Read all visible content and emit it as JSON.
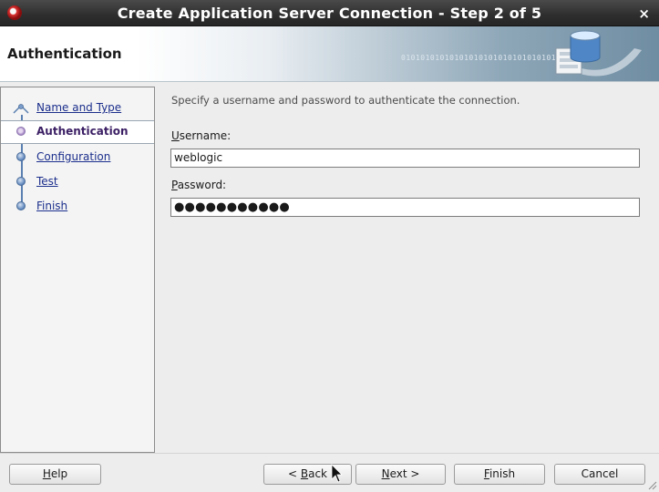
{
  "window": {
    "title": "Create Application Server Connection - Step 2 of 5",
    "close_glyph": "×"
  },
  "header": {
    "title": "Authentication",
    "binary_text": "0101010101010101010101010101010101"
  },
  "nav": {
    "items": [
      {
        "label": "Name and Type",
        "state": "visited"
      },
      {
        "label": "Authentication",
        "state": "current"
      },
      {
        "label": "Configuration",
        "state": "pending"
      },
      {
        "label": "Test",
        "state": "pending"
      },
      {
        "label": "Finish",
        "state": "pending"
      }
    ]
  },
  "content": {
    "description": "Specify a username and password to authenticate the connection.",
    "username": {
      "mnemonic": "U",
      "rest": "sername:",
      "value": "weblogic"
    },
    "password": {
      "mnemonic": "P",
      "rest": "assword:",
      "value": "●●●●●●●●●●●"
    }
  },
  "buttons": {
    "help": {
      "mnemonic": "H",
      "rest": "elp"
    },
    "back": {
      "prefix": "< ",
      "mnemonic": "B",
      "rest": "ack"
    },
    "next": {
      "mnemonic": "N",
      "rest": "ext >"
    },
    "finish": {
      "mnemonic": "F",
      "rest": "inish"
    },
    "cancel": {
      "label": "Cancel"
    }
  },
  "colors": {
    "titlebar": "#2e2e2e",
    "link": "#1c2f8c",
    "active_nav": "#3b1f64",
    "dot": "#5e86bd"
  },
  "icons": [
    "app-icon",
    "close-icon",
    "server-graphic-icon",
    "step-dot-icon",
    "mouse-cursor-icon",
    "resize-grip-icon"
  ]
}
